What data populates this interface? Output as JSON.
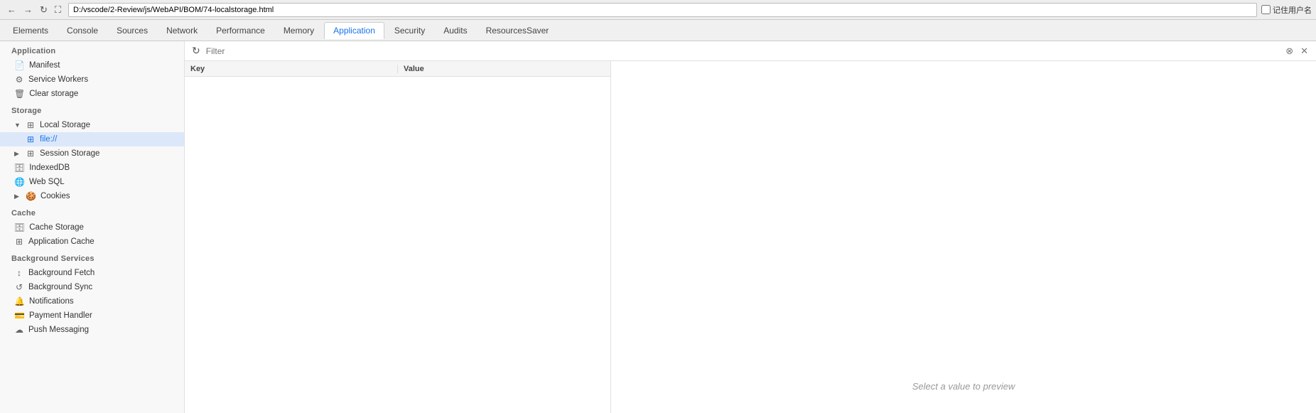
{
  "topbar": {
    "address": "D:/vscode/2-Review/js/WebAPI/BOM/74-localstorage.html",
    "remember_label": "记住用户名"
  },
  "tabs": [
    {
      "label": "Elements",
      "active": false
    },
    {
      "label": "Console",
      "active": false
    },
    {
      "label": "Sources",
      "active": false
    },
    {
      "label": "Network",
      "active": false
    },
    {
      "label": "Performance",
      "active": false
    },
    {
      "label": "Memory",
      "active": false
    },
    {
      "label": "Application",
      "active": true
    },
    {
      "label": "Security",
      "active": false
    },
    {
      "label": "Audits",
      "active": false
    },
    {
      "label": "ResourcesSaver",
      "active": false
    }
  ],
  "sidebar": {
    "app_section": "Application",
    "app_items": [
      {
        "label": "Manifest",
        "icon": "📄",
        "sub": false
      },
      {
        "label": "Service Workers",
        "icon": "⚙",
        "sub": false
      },
      {
        "label": "Clear storage",
        "icon": "🗑",
        "sub": false
      }
    ],
    "storage_section": "Storage",
    "storage_items": [
      {
        "label": "Local Storage",
        "icon": "▦",
        "sub": false,
        "expanded": true,
        "has_arrow": true,
        "arrow_down": true
      },
      {
        "label": "file://",
        "icon": "▦",
        "sub": true,
        "active": true
      },
      {
        "label": "Session Storage",
        "icon": "▦",
        "sub": false,
        "has_arrow": true,
        "arrow_right": true
      },
      {
        "label": "IndexedDB",
        "icon": "🗄",
        "sub": false
      },
      {
        "label": "Web SQL",
        "icon": "🌐",
        "sub": false
      },
      {
        "label": "Cookies",
        "icon": "🍪",
        "sub": false,
        "has_arrow": true,
        "arrow_right": true
      }
    ],
    "cache_section": "Cache",
    "cache_items": [
      {
        "label": "Cache Storage",
        "icon": "🗄",
        "sub": false
      },
      {
        "label": "Application Cache",
        "icon": "▦",
        "sub": false
      }
    ],
    "bg_section": "Background Services",
    "bg_items": [
      {
        "label": "Background Fetch",
        "icon": "↕",
        "sub": false
      },
      {
        "label": "Background Sync",
        "icon": "↺",
        "sub": false
      },
      {
        "label": "Notifications",
        "icon": "🔔",
        "sub": false
      },
      {
        "label": "Payment Handler",
        "icon": "💳",
        "sub": false
      },
      {
        "label": "Push Messaging",
        "icon": "☁",
        "sub": false
      }
    ]
  },
  "toolbar": {
    "filter_placeholder": "Filter",
    "key_col": "Key",
    "value_col": "Value"
  },
  "preview": {
    "hint": "Select a value to preview"
  }
}
